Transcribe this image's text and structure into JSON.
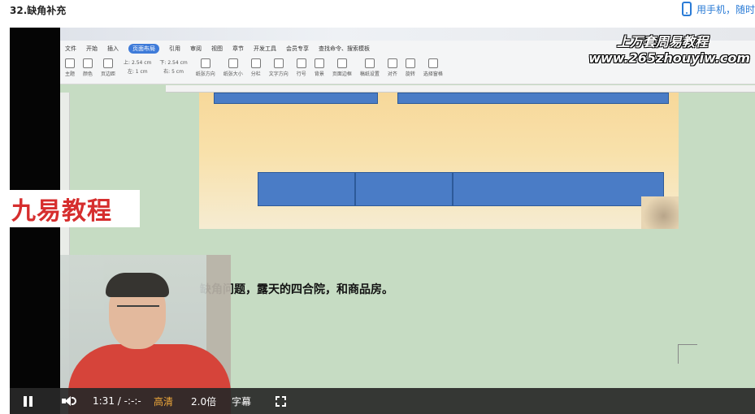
{
  "header": {
    "title": "32.缺角补充",
    "phone_link": "用手机，随时"
  },
  "ribbon": {
    "menu": [
      "文件",
      "开始",
      "插入",
      "页面布局",
      "引用",
      "审阅",
      "视图",
      "章节",
      "开发工具",
      "会员专享"
    ],
    "active_tab": "页面布局",
    "search_placeholder": "查找命令、搜索模板",
    "tools": [
      "主题",
      "颜色",
      "页边距",
      "纸张方向",
      "纸张大小",
      "分栏",
      "文字方向",
      "行号",
      "背景",
      "页面边框",
      "稿纸设置",
      "对齐",
      "旋转",
      "选择窗格"
    ],
    "margin_top": "上: 2.54 cm",
    "margin_bottom": "下: 2.54 cm",
    "margin_left": "左: 1 cm",
    "margin_right": "右: 5 cm"
  },
  "watermark": {
    "line1": "上万套周易教程",
    "line2": "www.265zhouyiw.com"
  },
  "logo": "九易教程",
  "document": {
    "text": "缺角问题，露天的四合院，和商品房。"
  },
  "controls": {
    "time": "1:31 / -:-:-",
    "quality": "高清",
    "speed": "2.0倍",
    "subtitle": "字幕"
  }
}
